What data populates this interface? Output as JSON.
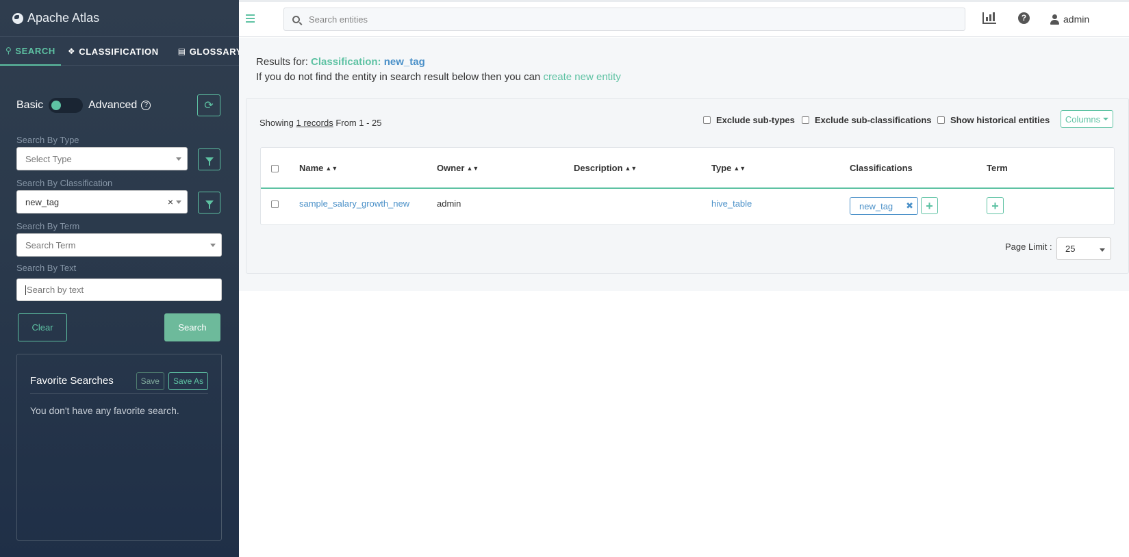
{
  "app": {
    "title": "Apache Atlas"
  },
  "sidebar": {
    "tabs": [
      {
        "label": "SEARCH",
        "active": true
      },
      {
        "label": "CLASSIFICATION",
        "active": false
      },
      {
        "label": "GLOSSARY",
        "active": false
      }
    ],
    "mode": {
      "basic_label": "Basic",
      "advanced_label": "Advanced",
      "help_glyph": "?"
    },
    "search_by_type": {
      "label": "Search By Type",
      "placeholder": "Select Type"
    },
    "search_by_classification": {
      "label": "Search By Classification",
      "value": "new_tag"
    },
    "search_by_term": {
      "label": "Search By Term",
      "placeholder": "Search Term"
    },
    "search_by_text": {
      "label": "Search By Text",
      "placeholder": "Search by text"
    },
    "clear_label": "Clear",
    "search_label": "Search",
    "favorites": {
      "title": "Favorite Searches",
      "save_label": "Save",
      "save_as_label": "Save As",
      "empty_text": "You don't have any favorite search."
    }
  },
  "topbar": {
    "search_placeholder": "Search entities",
    "user_name": "admin",
    "help_glyph": "?"
  },
  "results": {
    "prefix": "Results for:",
    "classification_label": "Classification:",
    "tag_name": "new_tag",
    "hint_text": "If you do not find the entity in search result below then you can",
    "create_link": "create new entity",
    "showing_prefix": "Showing",
    "records_link": "1 records",
    "range_text": "From 1 - 25",
    "options": {
      "exclude_subtypes": "Exclude sub-types",
      "exclude_subclassifications": "Exclude sub-classifications",
      "show_historical": "Show historical entities"
    },
    "columns_label": "Columns",
    "table": {
      "headers": [
        "Name",
        "Owner",
        "Description",
        "Type",
        "Classifications",
        "Term"
      ],
      "rows": [
        {
          "name": "sample_salary_growth_new",
          "owner": "admin",
          "description": "",
          "type": "hive_table",
          "classification": "new_tag"
        }
      ]
    },
    "page_limit_label": "Page Limit :",
    "page_limit_value": "25"
  },
  "colors": {
    "accent": "#5ec2a3",
    "link": "#4a90c8",
    "sidebar_bg": "#2f3d4e"
  }
}
